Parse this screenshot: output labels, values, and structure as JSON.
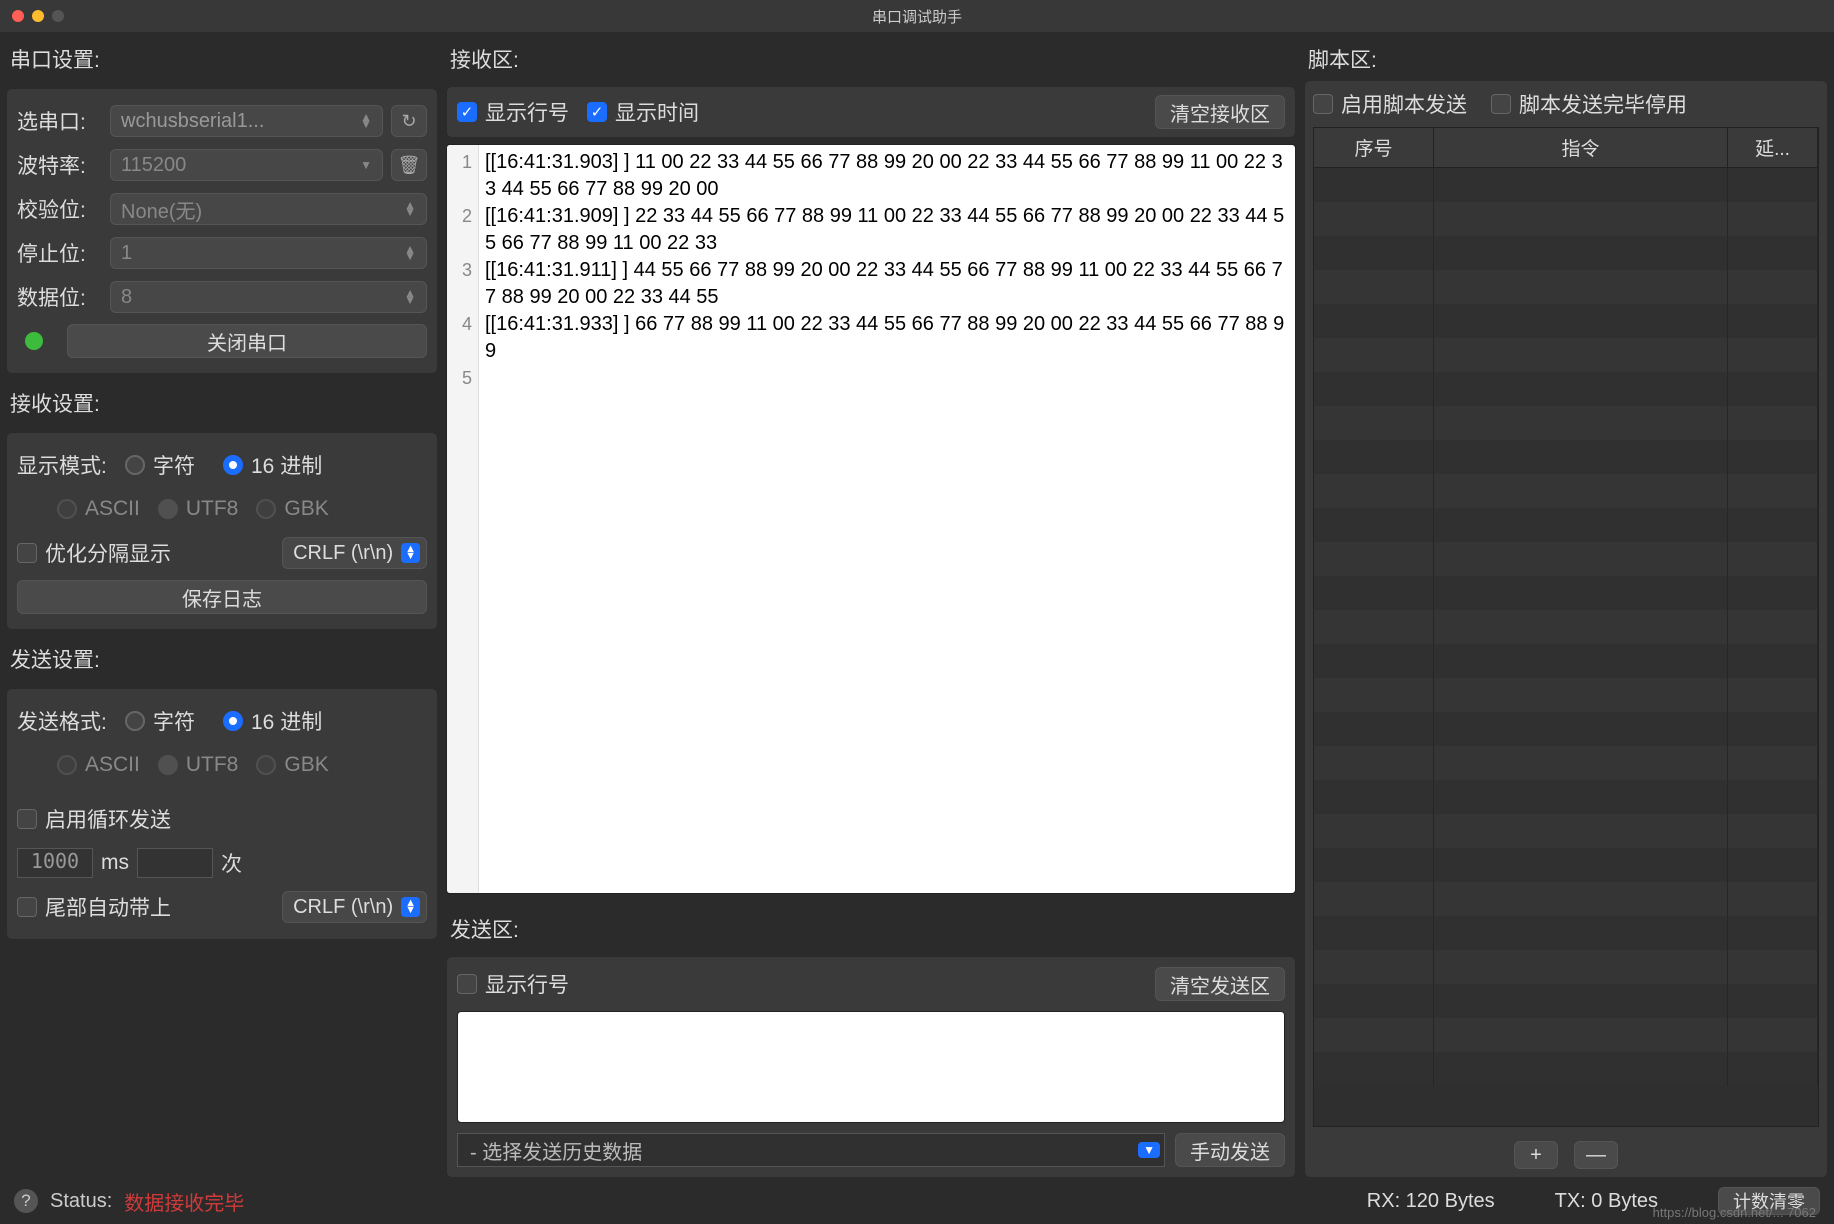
{
  "window_title": "串口调试助手",
  "sidebar": {
    "port_settings_label": "串口设置:",
    "select_port_label": "选串口:",
    "port_value": "wchusbserial1...",
    "baud_label": "波特率:",
    "baud_value": "115200",
    "parity_label": "校验位:",
    "parity_value": "None(无)",
    "stop_label": "停止位:",
    "stop_value": "1",
    "data_label": "数据位:",
    "data_value": "8",
    "close_port_btn": "关闭串口",
    "recv_settings_label": "接收设置:",
    "display_mode_label": "显示模式:",
    "char_label": "字符",
    "hex_label": "16 进制",
    "ascii": "ASCII",
    "utf8": "UTF8",
    "gbk": "GBK",
    "opt_split_label": "优化分隔显示",
    "crlf_value": "CRLF (\\r\\n)",
    "save_log_btn": "保存日志",
    "send_settings_label": "发送设置:",
    "send_format_label": "发送格式:",
    "enable_loop_label": "启用循环发送",
    "ms_value": "1000",
    "ms_label": "ms",
    "times_label": "次",
    "tail_auto_label": "尾部自动带上"
  },
  "recv": {
    "area_label": "接收区:",
    "show_line_no": "显示行号",
    "show_time": "显示时间",
    "clear_btn": "清空接收区",
    "lines": [
      "[[16:41:31.903] ] 11 00 22 33 44 55 66 77 88 99 20 00 22 33 44 55 66 77 88 99 11 00 22 33 44 55 66 77 88 99 20 00",
      "[[16:41:31.909] ] 22 33 44 55 66 77 88 99 11 00 22 33 44 55 66 77 88 99 20 00 22 33 44 55 66 77 88 99 11 00 22 33",
      "[[16:41:31.911] ] 44 55 66 77 88 99 20 00 22 33 44 55 66 77 88 99 11 00 22 33 44 55 66 77 88 99 20 00 22 33 44 55",
      "[[16:41:31.933] ] 66 77 88 99 11 00 22 33 44 55 66 77 88 99 20 00 22 33 44 55 66 77 88 99"
    ]
  },
  "send": {
    "area_label": "发送区:",
    "show_line_no": "显示行号",
    "clear_btn": "清空发送区",
    "history_placeholder": "- 选择发送历史数据",
    "manual_send_btn": "手动发送"
  },
  "script": {
    "area_label": "脚本区:",
    "enable_label": "启用脚本发送",
    "stop_on_done_label": "脚本发送完毕停用",
    "col_seq": "序号",
    "col_cmd": "指令",
    "col_delay": "延...",
    "add": "+",
    "remove": "—"
  },
  "status": {
    "label": "Status:",
    "msg": "数据接收完毕",
    "rx": "RX:  120 Bytes",
    "tx": "TX:  0 Bytes",
    "reset_btn": "计数清零",
    "watermark": "https://blog.csdn.net/... 7062"
  }
}
